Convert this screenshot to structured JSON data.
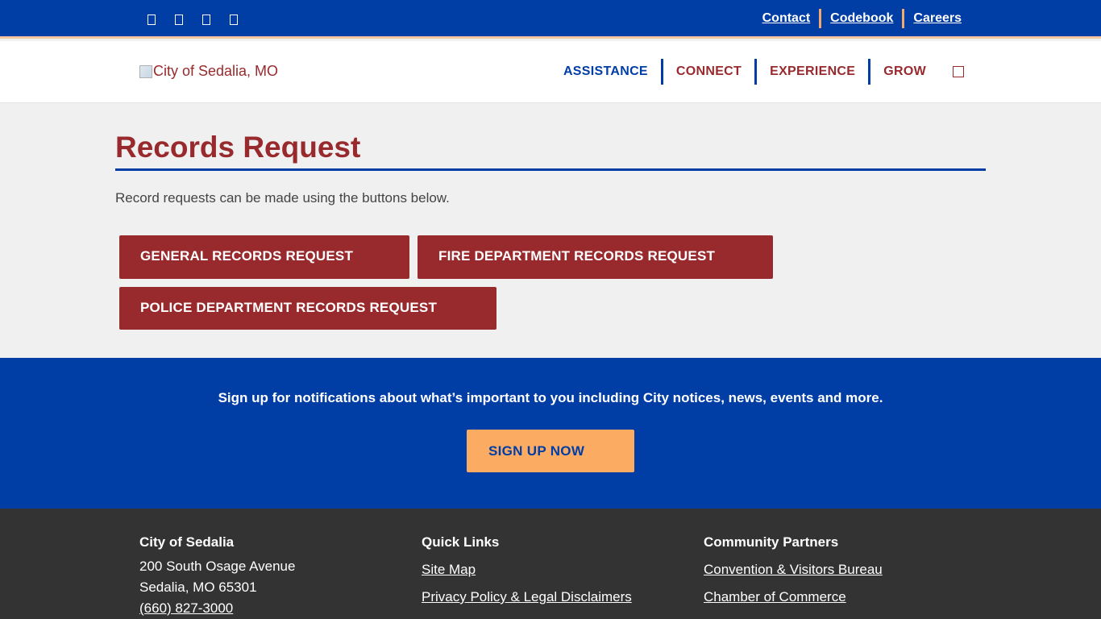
{
  "topbar": {
    "social_icons": [
      "facebook-icon",
      "twitter-icon",
      "instagram-icon",
      "youtube-icon"
    ],
    "links": [
      "Contact",
      "Codebook",
      "Careers"
    ]
  },
  "header": {
    "logo_alt": "City of Sedalia, MO",
    "nav": [
      "ASSISTANCE",
      "CONNECT",
      "EXPERIENCE",
      "GROW"
    ],
    "search_icon": "search-icon"
  },
  "main": {
    "title": "Records Request",
    "intro": "Record requests can be made using the buttons below.",
    "buttons": [
      "GENERAL RECORDS REQUEST",
      "FIRE DEPARTMENT RECORDS REQUEST",
      "POLICE DEPARTMENT RECORDS REQUEST"
    ]
  },
  "signup": {
    "text": "Sign up for notifications about what’s important to you including City notices, news, events and more.",
    "button": "SIGN UP NOW"
  },
  "footer": {
    "col1": {
      "heading": "City of Sedalia",
      "address1": "200 South Osage Avenue",
      "address2": "Sedalia, MO 65301",
      "phone": "(660) 827-3000"
    },
    "col2": {
      "heading": "Quick Links",
      "links": [
        "Site Map",
        "Privacy Policy & Legal Disclaimers"
      ]
    },
    "col3": {
      "heading": "Community Partners",
      "links": [
        "Convention & Visitors Bureau",
        "Chamber of Commerce"
      ]
    }
  },
  "colors": {
    "brand_blue": "#003da5",
    "brand_red": "#982a2d",
    "accent_orange": "#fcab63",
    "footer_bg": "#333333"
  }
}
